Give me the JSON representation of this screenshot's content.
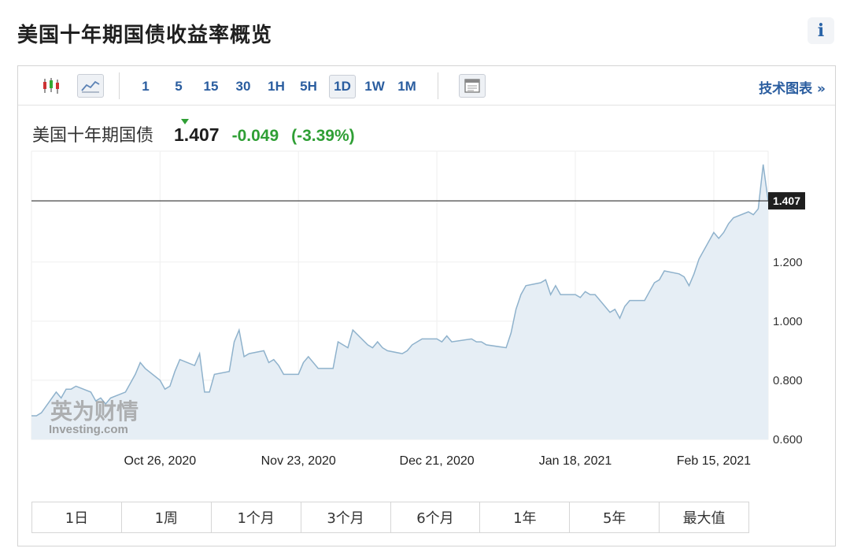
{
  "page": {
    "title": "美国十年期国债收益率概览",
    "info_label": "i"
  },
  "toolbar": {
    "icons": [
      "candlestick-icon",
      "line-chart-icon",
      "calendar-icon"
    ],
    "intervals": [
      "1",
      "5",
      "15",
      "30",
      "1H",
      "5H",
      "1D",
      "1W",
      "1M"
    ],
    "active_interval": "1D",
    "tech_link": "技术图表 »"
  },
  "quote": {
    "name": "美国十年期国债",
    "price": "1.407",
    "change": "-0.049",
    "change_pct": "(-3.39%)",
    "color_down": "#2f9f35"
  },
  "watermark": {
    "line1": "英为财情",
    "line2": "Investing.com"
  },
  "ranges": [
    "1日",
    "1周",
    "1个月",
    "3个月",
    "6个月",
    "1年",
    "5年",
    "最大值"
  ],
  "chart_data": {
    "type": "area",
    "x_start": "2020-09-30",
    "x_end": "2021-02-26",
    "x_ticks": [
      {
        "date": "2020-10-26",
        "label": "Oct 26, 2020"
      },
      {
        "date": "2020-11-23",
        "label": "Nov 23, 2020"
      },
      {
        "date": "2020-12-21",
        "label": "Dec 21, 2020"
      },
      {
        "date": "2021-01-18",
        "label": "Jan 18, 2021"
      },
      {
        "date": "2021-02-15",
        "label": "Feb 15, 2021"
      }
    ],
    "y_ticks": [
      0.6,
      0.8,
      1.0,
      1.2
    ],
    "y_tick_labels": [
      "0.600",
      "0.800",
      "1.000",
      "1.200"
    ],
    "ylim": [
      0.6,
      1.575
    ],
    "current_value": 1.407,
    "current_label": "1.407",
    "line_color": "#8fb2cc",
    "fill_color": "#e6eef5",
    "series": [
      {
        "x": [
          "2020-09-30",
          "2020-10-01",
          "2020-10-02",
          "2020-10-05",
          "2020-10-06",
          "2020-10-07",
          "2020-10-08",
          "2020-10-09",
          "2020-10-12",
          "2020-10-13",
          "2020-10-14",
          "2020-10-15",
          "2020-10-16",
          "2020-10-19",
          "2020-10-20",
          "2020-10-21",
          "2020-10-22",
          "2020-10-23",
          "2020-10-26",
          "2020-10-27",
          "2020-10-28",
          "2020-10-29",
          "2020-10-30",
          "2020-11-02",
          "2020-11-03",
          "2020-11-04",
          "2020-11-05",
          "2020-11-06",
          "2020-11-09",
          "2020-11-10",
          "2020-11-11",
          "2020-11-12",
          "2020-11-13",
          "2020-11-16",
          "2020-11-17",
          "2020-11-18",
          "2020-11-19",
          "2020-11-20",
          "2020-11-23",
          "2020-11-24",
          "2020-11-25",
          "2020-11-27",
          "2020-11-30",
          "2020-12-01",
          "2020-12-02",
          "2020-12-03",
          "2020-12-04",
          "2020-12-07",
          "2020-12-08",
          "2020-12-09",
          "2020-12-10",
          "2020-12-11",
          "2020-12-14",
          "2020-12-15",
          "2020-12-16",
          "2020-12-17",
          "2020-12-18",
          "2020-12-21",
          "2020-12-22",
          "2020-12-23",
          "2020-12-24",
          "2020-12-28",
          "2020-12-29",
          "2020-12-30",
          "2020-12-31",
          "2021-01-04",
          "2021-01-05",
          "2021-01-06",
          "2021-01-07",
          "2021-01-08",
          "2021-01-11",
          "2021-01-12",
          "2021-01-13",
          "2021-01-14",
          "2021-01-15",
          "2021-01-18",
          "2021-01-19",
          "2021-01-20",
          "2021-01-21",
          "2021-01-22",
          "2021-01-25",
          "2021-01-26",
          "2021-01-27",
          "2021-01-28",
          "2021-01-29",
          "2021-02-01",
          "2021-02-02",
          "2021-02-03",
          "2021-02-04",
          "2021-02-05",
          "2021-02-08",
          "2021-02-09",
          "2021-02-10",
          "2021-02-11",
          "2021-02-12",
          "2021-02-15",
          "2021-02-16",
          "2021-02-17",
          "2021-02-18",
          "2021-02-19",
          "2021-02-22",
          "2021-02-23",
          "2021-02-24",
          "2021-02-25",
          "2021-02-26"
        ],
        "y": [
          0.68,
          0.68,
          0.69,
          0.76,
          0.74,
          0.77,
          0.77,
          0.78,
          0.76,
          0.73,
          0.74,
          0.72,
          0.74,
          0.76,
          0.79,
          0.82,
          0.86,
          0.84,
          0.8,
          0.77,
          0.78,
          0.83,
          0.87,
          0.85,
          0.89,
          0.76,
          0.76,
          0.82,
          0.83,
          0.93,
          0.97,
          0.88,
          0.89,
          0.9,
          0.86,
          0.87,
          0.85,
          0.82,
          0.82,
          0.86,
          0.88,
          0.84,
          0.84,
          0.93,
          0.92,
          0.91,
          0.97,
          0.92,
          0.91,
          0.93,
          0.91,
          0.9,
          0.89,
          0.9,
          0.92,
          0.93,
          0.94,
          0.94,
          0.93,
          0.95,
          0.93,
          0.94,
          0.93,
          0.93,
          0.92,
          0.91,
          0.96,
          1.04,
          1.09,
          1.12,
          1.13,
          1.14,
          1.09,
          1.12,
          1.09,
          1.09,
          1.08,
          1.1,
          1.09,
          1.09,
          1.03,
          1.04,
          1.01,
          1.05,
          1.07,
          1.07,
          1.1,
          1.13,
          1.14,
          1.17,
          1.16,
          1.15,
          1.12,
          1.16,
          1.21,
          1.3,
          1.28,
          1.3,
          1.33,
          1.35,
          1.37,
          1.36,
          1.38,
          1.53,
          1.407
        ]
      }
    ]
  }
}
